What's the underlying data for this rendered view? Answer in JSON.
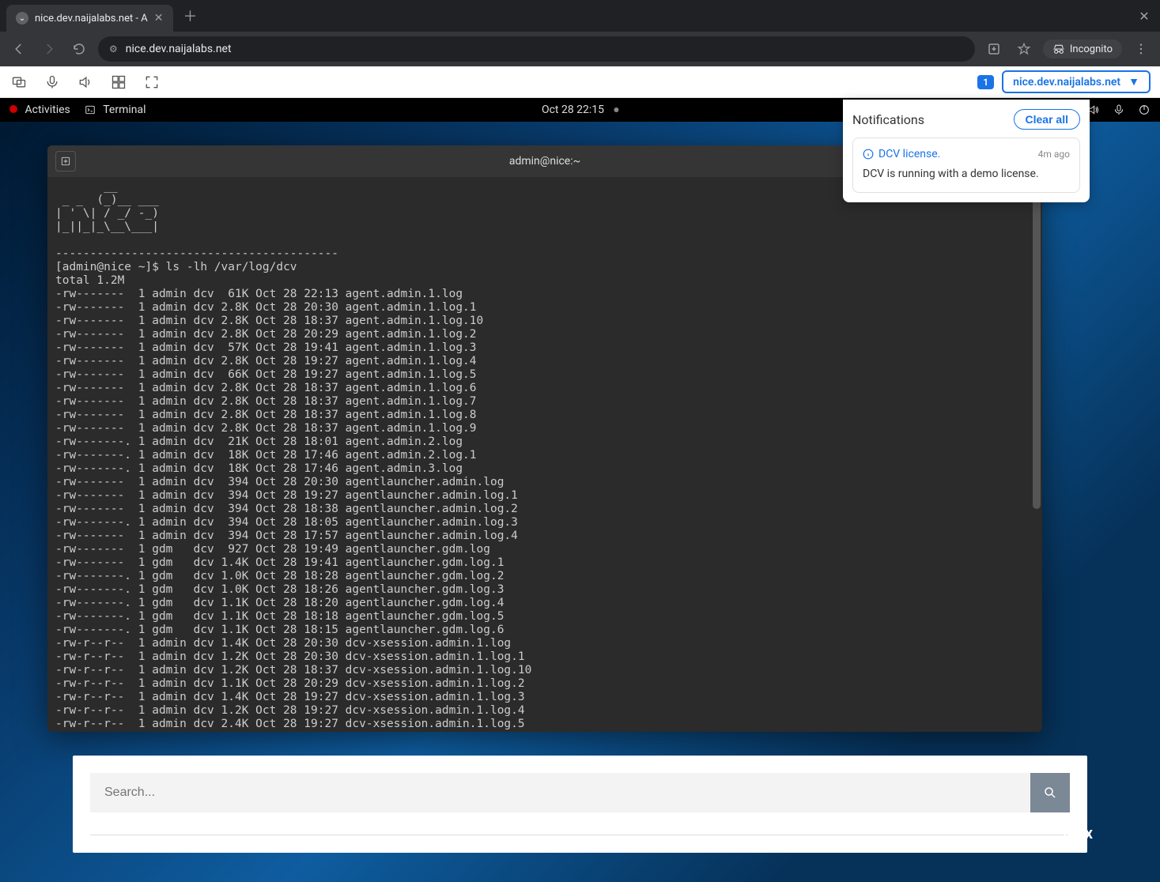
{
  "browser": {
    "tab_title": "nice.dev.naijalabs.net - A",
    "address": "nice.dev.naijalabs.net",
    "incognito_label": "Incognito"
  },
  "dcv_toolbar": {
    "badge_count": "1",
    "host_label": "nice.dev.naijalabs.net"
  },
  "notifications": {
    "title": "Notifications",
    "clear_label": "Clear all",
    "items": [
      {
        "link": "DCV license.",
        "time": "4m ago",
        "body": "DCV is running with a demo license."
      }
    ]
  },
  "gnome": {
    "activities": "Activities",
    "terminal": "Terminal",
    "clock": "Oct 28  22:15"
  },
  "terminal": {
    "title": "admin@nice:~",
    "ascii": "       __\n _ _  (_)__ ___\n| ' \\| / _/ -_)\n|_||_|_\\__\\___|\n\n-----------------------------------------",
    "prompt": "[admin@nice ~]$ ",
    "command": "ls -lh /var/log/dcv",
    "total": "total 1.2M",
    "rows": [
      {
        "perm": "-rw-------",
        "dot": " ",
        "n": "1",
        "owner": "admin",
        "grp": "dcv",
        "size": " 61K",
        "date": "Oct 28 22:13",
        "name": "agent.admin.1.log"
      },
      {
        "perm": "-rw-------",
        "dot": " ",
        "n": "1",
        "owner": "admin",
        "grp": "dcv",
        "size": "2.8K",
        "date": "Oct 28 20:30",
        "name": "agent.admin.1.log.1"
      },
      {
        "perm": "-rw-------",
        "dot": " ",
        "n": "1",
        "owner": "admin",
        "grp": "dcv",
        "size": "2.8K",
        "date": "Oct 28 18:37",
        "name": "agent.admin.1.log.10"
      },
      {
        "perm": "-rw-------",
        "dot": " ",
        "n": "1",
        "owner": "admin",
        "grp": "dcv",
        "size": "2.8K",
        "date": "Oct 28 20:29",
        "name": "agent.admin.1.log.2"
      },
      {
        "perm": "-rw-------",
        "dot": " ",
        "n": "1",
        "owner": "admin",
        "grp": "dcv",
        "size": " 57K",
        "date": "Oct 28 19:41",
        "name": "agent.admin.1.log.3"
      },
      {
        "perm": "-rw-------",
        "dot": " ",
        "n": "1",
        "owner": "admin",
        "grp": "dcv",
        "size": "2.8K",
        "date": "Oct 28 19:27",
        "name": "agent.admin.1.log.4"
      },
      {
        "perm": "-rw-------",
        "dot": " ",
        "n": "1",
        "owner": "admin",
        "grp": "dcv",
        "size": " 66K",
        "date": "Oct 28 19:27",
        "name": "agent.admin.1.log.5"
      },
      {
        "perm": "-rw-------",
        "dot": " ",
        "n": "1",
        "owner": "admin",
        "grp": "dcv",
        "size": "2.8K",
        "date": "Oct 28 18:37",
        "name": "agent.admin.1.log.6"
      },
      {
        "perm": "-rw-------",
        "dot": " ",
        "n": "1",
        "owner": "admin",
        "grp": "dcv",
        "size": "2.8K",
        "date": "Oct 28 18:37",
        "name": "agent.admin.1.log.7"
      },
      {
        "perm": "-rw-------",
        "dot": " ",
        "n": "1",
        "owner": "admin",
        "grp": "dcv",
        "size": "2.8K",
        "date": "Oct 28 18:37",
        "name": "agent.admin.1.log.8"
      },
      {
        "perm": "-rw-------",
        "dot": " ",
        "n": "1",
        "owner": "admin",
        "grp": "dcv",
        "size": "2.8K",
        "date": "Oct 28 18:37",
        "name": "agent.admin.1.log.9"
      },
      {
        "perm": "-rw-------",
        "dot": ".",
        "n": "1",
        "owner": "admin",
        "grp": "dcv",
        "size": " 21K",
        "date": "Oct 28 18:01",
        "name": "agent.admin.2.log"
      },
      {
        "perm": "-rw-------",
        "dot": ".",
        "n": "1",
        "owner": "admin",
        "grp": "dcv",
        "size": " 18K",
        "date": "Oct 28 17:46",
        "name": "agent.admin.2.log.1"
      },
      {
        "perm": "-rw-------",
        "dot": ".",
        "n": "1",
        "owner": "admin",
        "grp": "dcv",
        "size": " 18K",
        "date": "Oct 28 17:46",
        "name": "agent.admin.3.log"
      },
      {
        "perm": "-rw-------",
        "dot": " ",
        "n": "1",
        "owner": "admin",
        "grp": "dcv",
        "size": " 394",
        "date": "Oct 28 20:30",
        "name": "agentlauncher.admin.log"
      },
      {
        "perm": "-rw-------",
        "dot": " ",
        "n": "1",
        "owner": "admin",
        "grp": "dcv",
        "size": " 394",
        "date": "Oct 28 19:27",
        "name": "agentlauncher.admin.log.1"
      },
      {
        "perm": "-rw-------",
        "dot": " ",
        "n": "1",
        "owner": "admin",
        "grp": "dcv",
        "size": " 394",
        "date": "Oct 28 18:38",
        "name": "agentlauncher.admin.log.2"
      },
      {
        "perm": "-rw-------",
        "dot": ".",
        "n": "1",
        "owner": "admin",
        "grp": "dcv",
        "size": " 394",
        "date": "Oct 28 18:05",
        "name": "agentlauncher.admin.log.3"
      },
      {
        "perm": "-rw-------",
        "dot": " ",
        "n": "1",
        "owner": "admin",
        "grp": "dcv",
        "size": " 394",
        "date": "Oct 28 17:57",
        "name": "agentlauncher.admin.log.4"
      },
      {
        "perm": "-rw-------",
        "dot": " ",
        "n": "1",
        "owner": "gdm  ",
        "grp": "dcv",
        "size": " 927",
        "date": "Oct 28 19:49",
        "name": "agentlauncher.gdm.log"
      },
      {
        "perm": "-rw-------",
        "dot": " ",
        "n": "1",
        "owner": "gdm  ",
        "grp": "dcv",
        "size": "1.4K",
        "date": "Oct 28 19:41",
        "name": "agentlauncher.gdm.log.1"
      },
      {
        "perm": "-rw-------",
        "dot": ".",
        "n": "1",
        "owner": "gdm  ",
        "grp": "dcv",
        "size": "1.0K",
        "date": "Oct 28 18:28",
        "name": "agentlauncher.gdm.log.2"
      },
      {
        "perm": "-rw-------",
        "dot": ".",
        "n": "1",
        "owner": "gdm  ",
        "grp": "dcv",
        "size": "1.0K",
        "date": "Oct 28 18:26",
        "name": "agentlauncher.gdm.log.3"
      },
      {
        "perm": "-rw-------",
        "dot": ".",
        "n": "1",
        "owner": "gdm  ",
        "grp": "dcv",
        "size": "1.1K",
        "date": "Oct 28 18:20",
        "name": "agentlauncher.gdm.log.4"
      },
      {
        "perm": "-rw-------",
        "dot": ".",
        "n": "1",
        "owner": "gdm  ",
        "grp": "dcv",
        "size": "1.1K",
        "date": "Oct 28 18:18",
        "name": "agentlauncher.gdm.log.5"
      },
      {
        "perm": "-rw-------",
        "dot": ".",
        "n": "1",
        "owner": "gdm  ",
        "grp": "dcv",
        "size": "1.1K",
        "date": "Oct 28 18:15",
        "name": "agentlauncher.gdm.log.6"
      },
      {
        "perm": "-rw-r--r--",
        "dot": " ",
        "n": "1",
        "owner": "admin",
        "grp": "dcv",
        "size": "1.4K",
        "date": "Oct 28 20:30",
        "name": "dcv-xsession.admin.1.log"
      },
      {
        "perm": "-rw-r--r--",
        "dot": " ",
        "n": "1",
        "owner": "admin",
        "grp": "dcv",
        "size": "1.2K",
        "date": "Oct 28 20:30",
        "name": "dcv-xsession.admin.1.log.1"
      },
      {
        "perm": "-rw-r--r--",
        "dot": " ",
        "n": "1",
        "owner": "admin",
        "grp": "dcv",
        "size": "1.2K",
        "date": "Oct 28 18:37",
        "name": "dcv-xsession.admin.1.log.10"
      },
      {
        "perm": "-rw-r--r--",
        "dot": " ",
        "n": "1",
        "owner": "admin",
        "grp": "dcv",
        "size": "1.1K",
        "date": "Oct 28 20:29",
        "name": "dcv-xsession.admin.1.log.2"
      },
      {
        "perm": "-rw-r--r--",
        "dot": " ",
        "n": "1",
        "owner": "admin",
        "grp": "dcv",
        "size": "1.4K",
        "date": "Oct 28 19:27",
        "name": "dcv-xsession.admin.1.log.3"
      },
      {
        "perm": "-rw-r--r--",
        "dot": " ",
        "n": "1",
        "owner": "admin",
        "grp": "dcv",
        "size": "1.2K",
        "date": "Oct 28 19:27",
        "name": "dcv-xsession.admin.1.log.4"
      },
      {
        "perm": "-rw-r--r--",
        "dot": " ",
        "n": "1",
        "owner": "admin",
        "grp": "dcv",
        "size": "2.4K",
        "date": "Oct 28 19:27",
        "name": "dcv-xsession.admin.1.log.5"
      }
    ]
  },
  "search": {
    "placeholder": "Search..."
  },
  "footer": {
    "text": "inux"
  }
}
